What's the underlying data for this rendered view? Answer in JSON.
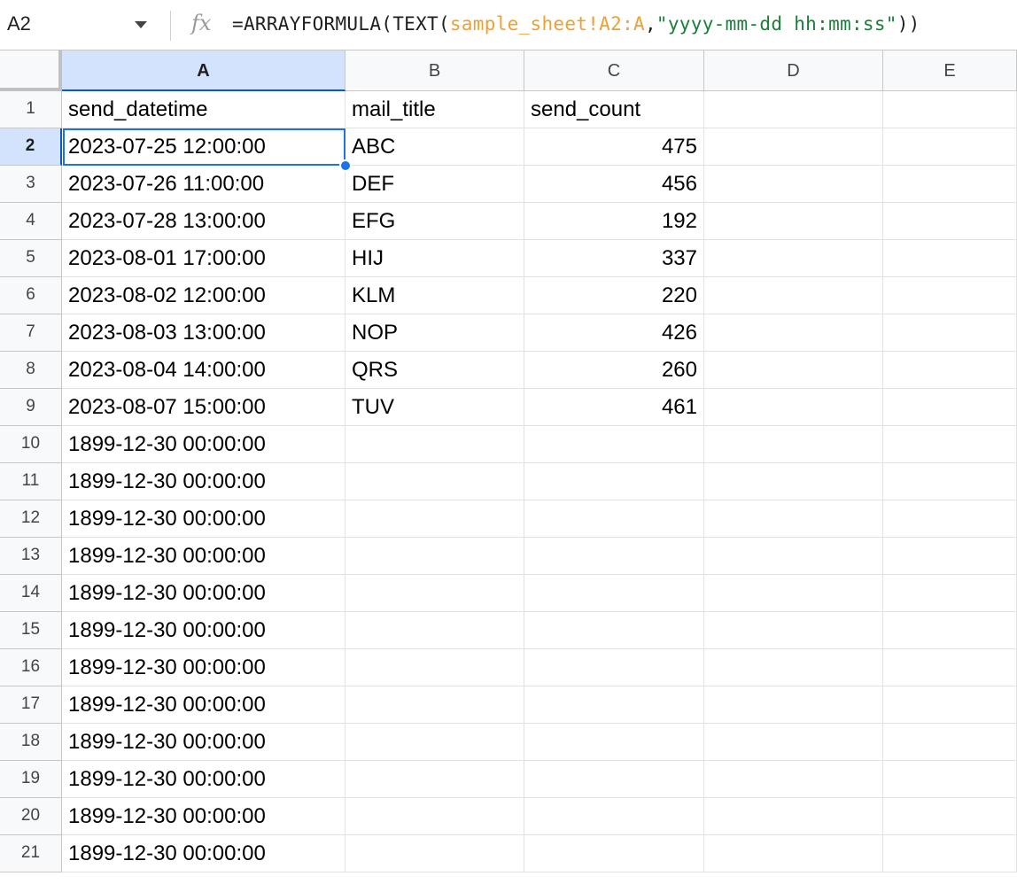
{
  "name_box": "A2",
  "formula": {
    "prefix": "=ARRAYFORMULA(TEXT(",
    "ref": "sample_sheet!A2:A",
    "comma": ",",
    "string": "\"yyyy-mm-dd hh:mm:ss\"",
    "suffix": "))"
  },
  "icons": {
    "fx": "fx",
    "name_box_dropdown": "chevron-down-icon"
  },
  "colors": {
    "accent": "#1a73e8",
    "selected_header": "#d3e3fd",
    "formula_ref": "#f0a030",
    "formula_string": "#188038"
  },
  "columns": [
    "A",
    "B",
    "C",
    "D",
    "E"
  ],
  "selected_cell": "A2",
  "rows": [
    {
      "n": "1",
      "a": "send_datetime",
      "b": "mail_title",
      "c": "send_count"
    },
    {
      "n": "2",
      "a": "2023-07-25 12:00:00",
      "b": "ABC",
      "c": "475"
    },
    {
      "n": "3",
      "a": "2023-07-26 11:00:00",
      "b": "DEF",
      "c": "456"
    },
    {
      "n": "4",
      "a": "2023-07-28 13:00:00",
      "b": "EFG",
      "c": "192"
    },
    {
      "n": "5",
      "a": "2023-08-01 17:00:00",
      "b": "HIJ",
      "c": "337"
    },
    {
      "n": "6",
      "a": "2023-08-02 12:00:00",
      "b": "KLM",
      "c": "220"
    },
    {
      "n": "7",
      "a": "2023-08-03 13:00:00",
      "b": "NOP",
      "c": "426"
    },
    {
      "n": "8",
      "a": "2023-08-04 14:00:00",
      "b": "QRS",
      "c": "260"
    },
    {
      "n": "9",
      "a": "2023-08-07 15:00:00",
      "b": "TUV",
      "c": "461"
    },
    {
      "n": "10",
      "a": "1899-12-30 00:00:00",
      "b": "",
      "c": ""
    },
    {
      "n": "11",
      "a": "1899-12-30 00:00:00",
      "b": "",
      "c": ""
    },
    {
      "n": "12",
      "a": "1899-12-30 00:00:00",
      "b": "",
      "c": ""
    },
    {
      "n": "13",
      "a": "1899-12-30 00:00:00",
      "b": "",
      "c": ""
    },
    {
      "n": "14",
      "a": "1899-12-30 00:00:00",
      "b": "",
      "c": ""
    },
    {
      "n": "15",
      "a": "1899-12-30 00:00:00",
      "b": "",
      "c": ""
    },
    {
      "n": "16",
      "a": "1899-12-30 00:00:00",
      "b": "",
      "c": ""
    },
    {
      "n": "17",
      "a": "1899-12-30 00:00:00",
      "b": "",
      "c": ""
    },
    {
      "n": "18",
      "a": "1899-12-30 00:00:00",
      "b": "",
      "c": ""
    },
    {
      "n": "19",
      "a": "1899-12-30 00:00:00",
      "b": "",
      "c": ""
    },
    {
      "n": "20",
      "a": "1899-12-30 00:00:00",
      "b": "",
      "c": ""
    },
    {
      "n": "21",
      "a": "1899-12-30 00:00:00",
      "b": "",
      "c": ""
    }
  ]
}
